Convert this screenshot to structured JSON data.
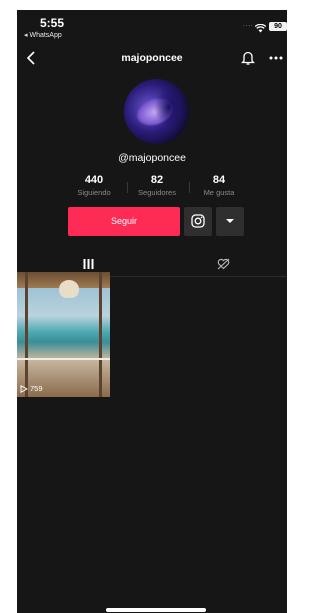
{
  "status_bar": {
    "time": "5:55",
    "back_app": "◂ WhatsApp",
    "signal": "....",
    "battery": "90"
  },
  "nav": {
    "title": "majoponcee"
  },
  "profile": {
    "handle": "@majoponcee",
    "stats": [
      {
        "value": "440",
        "label": "Siguiendo"
      },
      {
        "value": "82",
        "label": "Seguidores"
      },
      {
        "value": "84",
        "label": "Me gusta"
      }
    ]
  },
  "actions": {
    "follow_label": "Seguir",
    "secondary_icon": "instagram-icon",
    "dropdown_icon": "caret-down-icon"
  },
  "tabs": [
    {
      "name": "videos",
      "icon": "grid-icon",
      "active": true
    },
    {
      "name": "liked",
      "icon": "hidden-heart-icon",
      "active": false
    }
  ],
  "videos": [
    {
      "views": "759"
    }
  ],
  "colors": {
    "background": "#161616",
    "accent": "#fe2c55",
    "secondary_button": "#2f2f2f"
  }
}
